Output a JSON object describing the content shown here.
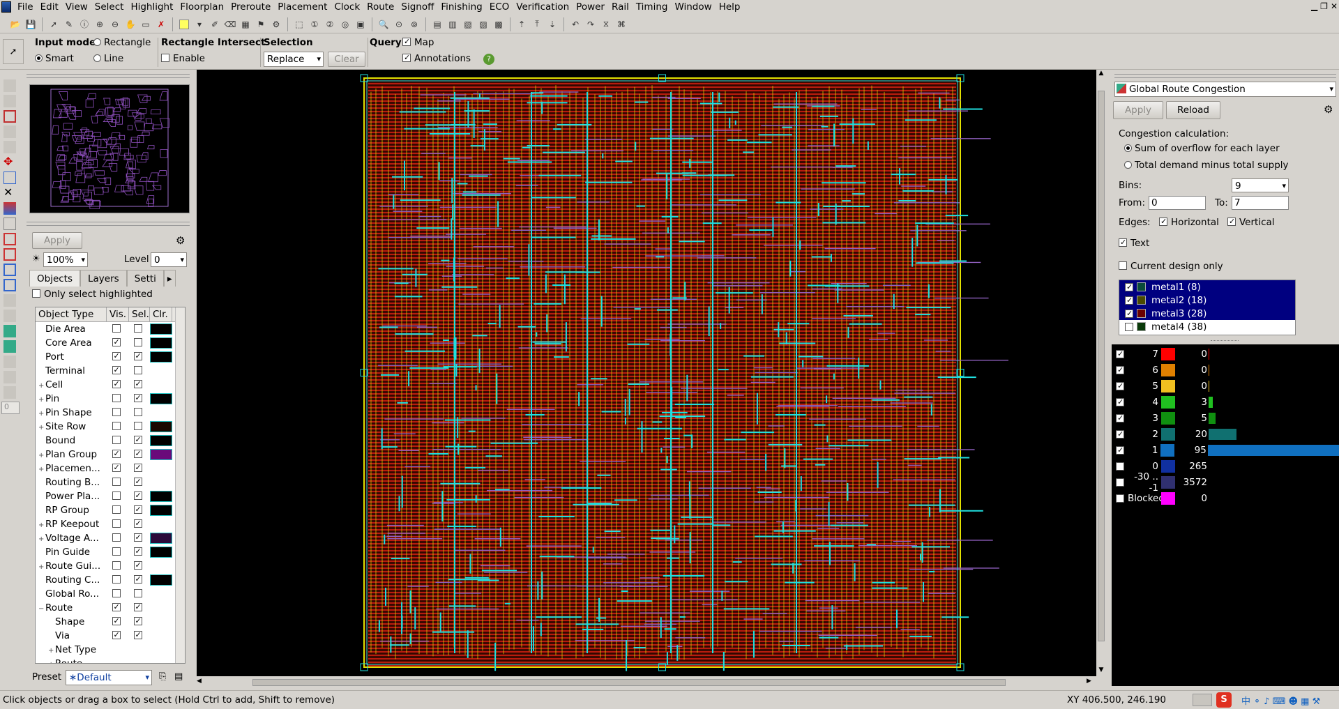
{
  "menu": [
    "File",
    "Edit",
    "View",
    "Select",
    "Highlight",
    "Floorplan",
    "Preroute",
    "Placement",
    "Clock",
    "Route",
    "Signoff",
    "Finishing",
    "ECO",
    "Verification",
    "Power",
    "Rail",
    "Timing",
    "Window",
    "Help"
  ],
  "options": {
    "input_mode_label": "Input mode",
    "rectangle": "Rectangle",
    "smart": "Smart",
    "line": "Line",
    "rect_intersect_label": "Rectangle Intersect",
    "enable": "Enable",
    "selection_label": "Selection",
    "selection_value": "Replace",
    "clear": "Clear",
    "query_label": "Query",
    "map": "Map",
    "annotations": "Annotations"
  },
  "left": {
    "apply": "Apply",
    "zoom": "100%",
    "level_label": "Level",
    "level_value": "0",
    "tabs": [
      "Objects",
      "Layers",
      "Setti"
    ],
    "only_select_highlighted": "Only select highlighted",
    "table_headers": [
      "Object Type",
      "Vis.",
      "Sel.",
      "Clr."
    ],
    "rows": [
      {
        "name": "Die Area",
        "indent": 0,
        "exp": "",
        "vis": false,
        "sel": false,
        "clr": "#000"
      },
      {
        "name": "Core Area",
        "indent": 0,
        "exp": "",
        "vis": true,
        "sel": false,
        "clr": "#000"
      },
      {
        "name": "Port",
        "indent": 0,
        "exp": "",
        "vis": true,
        "sel": true,
        "clr": "#000"
      },
      {
        "name": "Terminal",
        "indent": 0,
        "exp": "",
        "vis": true,
        "sel": false,
        "clr": ""
      },
      {
        "name": "Cell",
        "indent": 0,
        "exp": "+",
        "vis": true,
        "sel": true,
        "clr": ""
      },
      {
        "name": "Pin",
        "indent": 0,
        "exp": "+",
        "vis": false,
        "sel": true,
        "clr": "#000"
      },
      {
        "name": "Pin Shape",
        "indent": 0,
        "exp": "+",
        "vis": false,
        "sel": false,
        "clr": ""
      },
      {
        "name": "Site Row",
        "indent": 0,
        "exp": "+",
        "vis": false,
        "sel": false,
        "clr": "#1a0800"
      },
      {
        "name": "Bound",
        "indent": 0,
        "exp": "",
        "vis": false,
        "sel": true,
        "clr": "#000"
      },
      {
        "name": "Plan Group",
        "indent": 0,
        "exp": "+",
        "vis": true,
        "sel": true,
        "clr": "#6a0a7a"
      },
      {
        "name": "Placemen...",
        "indent": 0,
        "exp": "+",
        "vis": true,
        "sel": true,
        "clr": ""
      },
      {
        "name": "Routing B...",
        "indent": 0,
        "exp": "",
        "vis": false,
        "sel": true,
        "clr": ""
      },
      {
        "name": "Power Pla...",
        "indent": 0,
        "exp": "",
        "vis": false,
        "sel": true,
        "clr": "#000"
      },
      {
        "name": "RP Group",
        "indent": 0,
        "exp": "",
        "vis": false,
        "sel": true,
        "clr": "#000"
      },
      {
        "name": "RP Keepout",
        "indent": 0,
        "exp": "+",
        "vis": false,
        "sel": true,
        "clr": ""
      },
      {
        "name": "Voltage A...",
        "indent": 0,
        "exp": "+",
        "vis": false,
        "sel": true,
        "clr": "#2a0a3a"
      },
      {
        "name": "Pin Guide",
        "indent": 0,
        "exp": "",
        "vis": false,
        "sel": true,
        "clr": "#000"
      },
      {
        "name": "Route Gui...",
        "indent": 0,
        "exp": "+",
        "vis": false,
        "sel": true,
        "clr": ""
      },
      {
        "name": "Routing C...",
        "indent": 0,
        "exp": "",
        "vis": false,
        "sel": true,
        "clr": "#000"
      },
      {
        "name": "Global Ro...",
        "indent": 0,
        "exp": "",
        "vis": false,
        "sel": false,
        "clr": ""
      },
      {
        "name": "Route",
        "indent": 0,
        "exp": "−",
        "vis": true,
        "sel": true,
        "clr": ""
      },
      {
        "name": "Shape",
        "indent": 1,
        "exp": "",
        "vis": true,
        "sel": true,
        "clr": ""
      },
      {
        "name": "Via",
        "indent": 1,
        "exp": "",
        "vis": true,
        "sel": true,
        "clr": ""
      },
      {
        "name": "Net Type",
        "indent": 1,
        "exp": "+",
        "vis": null,
        "sel": null,
        "clr": ""
      },
      {
        "name": "Route",
        "indent": 1,
        "exp": "+",
        "vis": null,
        "sel": null,
        "clr": ""
      }
    ],
    "preset_label": "Preset",
    "preset_value": "∗Default"
  },
  "right": {
    "map_name": "Global Route Congestion",
    "apply": "Apply",
    "reload": "Reload",
    "congestion_calc": "Congestion calculation:",
    "opt_sum": "Sum of overflow for each layer",
    "opt_total": "Total demand minus total supply",
    "bins_label": "Bins:",
    "bins_value": "9",
    "from_label": "From:",
    "from_value": "0",
    "to_label": "To:",
    "to_value": "7",
    "edges_label": "Edges:",
    "horizontal": "Horizontal",
    "vertical": "Vertical",
    "text": "Text",
    "current_design_only": "Current design only",
    "layers": [
      {
        "name": "metal1 (8)",
        "checked": true,
        "selected": true,
        "sw": "#0a4a3a"
      },
      {
        "name": "metal2 (18)",
        "checked": true,
        "selected": true,
        "sw": "#4a4a00"
      },
      {
        "name": "metal3 (28)",
        "checked": true,
        "selected": true,
        "sw": "#6a0000"
      },
      {
        "name": "metal4 (38)",
        "checked": false,
        "selected": false,
        "sw": "#0a3a0a"
      }
    ],
    "bins": [
      {
        "label": "7",
        "color": "#ff0000",
        "count": "0",
        "frac": 0,
        "checked": true
      },
      {
        "label": "6",
        "color": "#e08000",
        "count": "0",
        "frac": 0,
        "checked": true
      },
      {
        "label": "5",
        "color": "#f0c020",
        "count": "0",
        "frac": 0,
        "checked": true
      },
      {
        "label": "4",
        "color": "#20c020",
        "count": "3",
        "frac": 0.03,
        "checked": true
      },
      {
        "label": "3",
        "color": "#109010",
        "count": "5",
        "frac": 0.05,
        "checked": true
      },
      {
        "label": "2",
        "color": "#107070",
        "count": "20",
        "frac": 0.21,
        "checked": true
      },
      {
        "label": "1",
        "color": "#1070c0",
        "count": "95",
        "frac": 1.0,
        "checked": true
      },
      {
        "label": "0",
        "color": "#1030a0",
        "count": "265",
        "frac": 0,
        "checked": false
      },
      {
        "label": "-30 .. -1",
        "color": "#303070",
        "count": "3572",
        "frac": 0,
        "checked": false
      },
      {
        "label": "Blocked",
        "color": "#ff00ff",
        "count": "0",
        "frac": 0,
        "checked": false
      }
    ]
  },
  "status": {
    "message": "Click objects or drag a box to select (Hold Ctrl to add, Shift to remove)",
    "coords": "XY 406.500, 246.190"
  },
  "colors": {
    "route_red": "#d02010",
    "route_yellow": "#e0e000",
    "route_cyan": "#20e0e0",
    "route_purple": "#9060c0",
    "selected_blue": "#000080"
  }
}
